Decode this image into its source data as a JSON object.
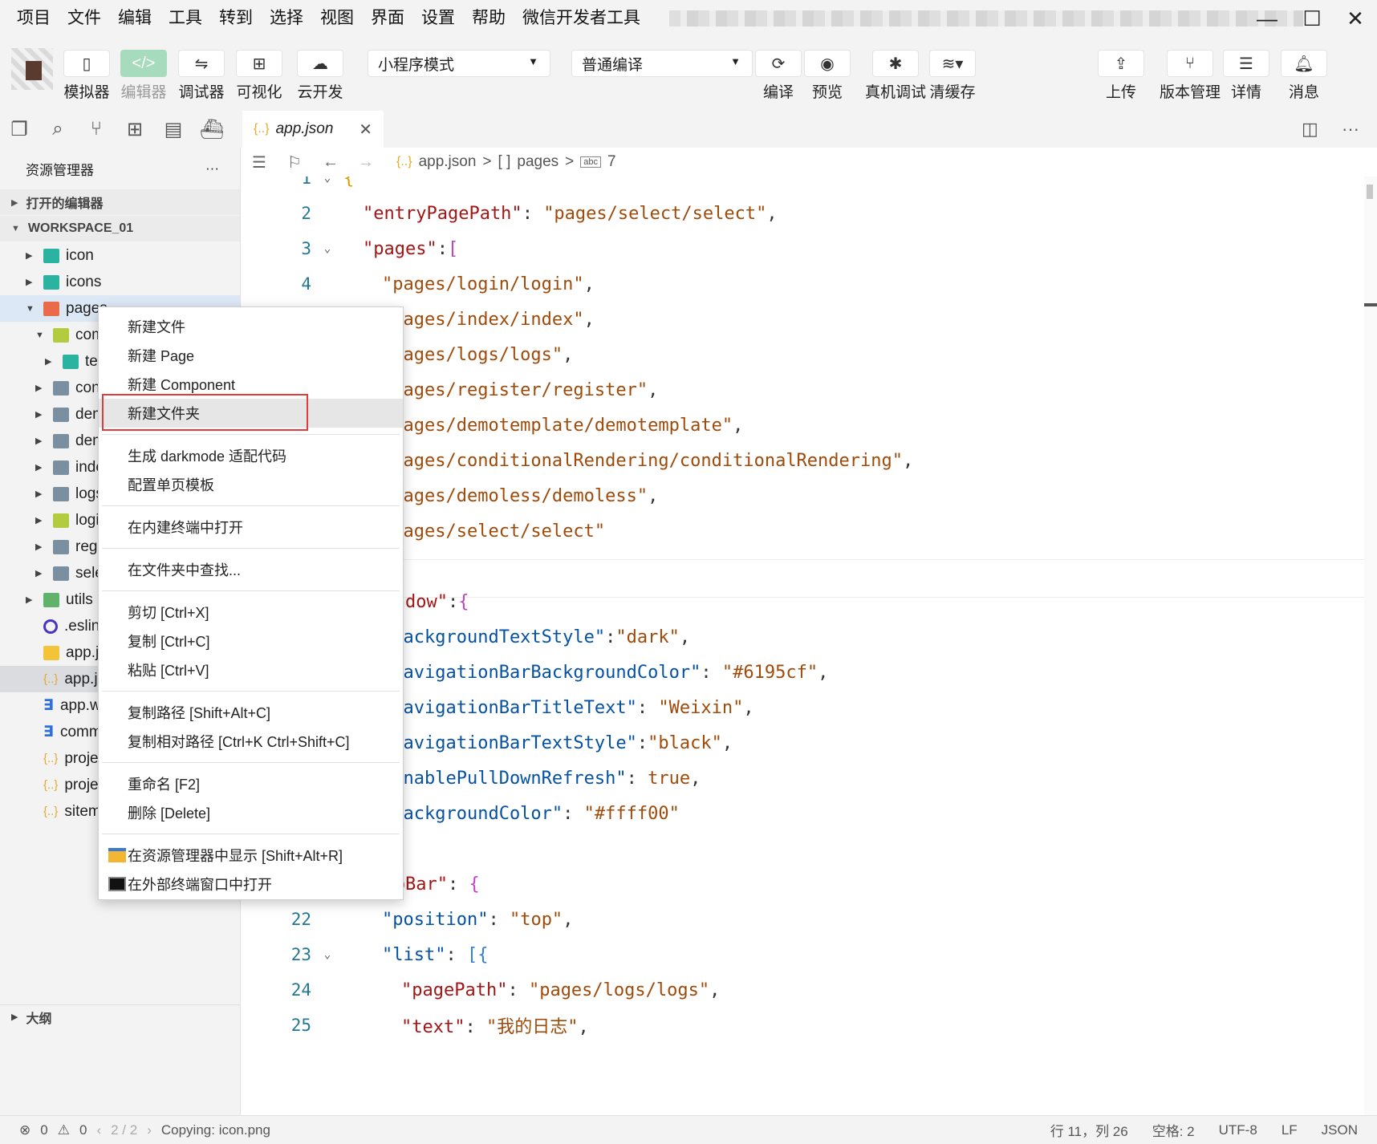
{
  "menubar": {
    "items": [
      "项目",
      "文件",
      "编辑",
      "工具",
      "转到",
      "选择",
      "视图",
      "界面",
      "设置",
      "帮助",
      "微信开发者工具"
    ],
    "window_controls": [
      "—",
      "☐",
      "✕"
    ]
  },
  "toolbar": {
    "simulator": "模拟器",
    "editor": "编辑器",
    "debugger": "调试器",
    "visual": "可视化",
    "cloud": "云开发",
    "mode_select": "小程序模式",
    "compile_select": "普通编译",
    "compile": "编译",
    "preview": "预览",
    "remote_debug": "真机调试",
    "clear_cache": "清缓存",
    "upload": "上传",
    "version": "版本管理",
    "details": "详情",
    "messages": "消息"
  },
  "sidebar": {
    "title": "资源管理器",
    "more": "···",
    "open_editors": "打开的编辑器",
    "workspace": "WORKSPACE_01",
    "outline": "大纲",
    "tree": [
      {
        "label": "icon",
        "icon": "folder-teal",
        "indent": 0,
        "arrow": "▶",
        "state": ""
      },
      {
        "label": "icons",
        "icon": "folder-teal",
        "indent": 0,
        "arrow": "▶",
        "state": ""
      },
      {
        "label": "pages",
        "icon": "folder-orange",
        "indent": 0,
        "arrow": "▼",
        "state": "active"
      },
      {
        "label": "components",
        "icon": "folder-lime",
        "indent": 1,
        "arrow": "▼",
        "state": ""
      },
      {
        "label": "te",
        "icon": "folder-teal",
        "indent": 2,
        "arrow": "▶",
        "state": ""
      },
      {
        "label": "conditionalRendering",
        "icon": "folder-gray",
        "indent": 1,
        "arrow": "▶",
        "state": ""
      },
      {
        "label": "demoless",
        "icon": "folder-gray",
        "indent": 1,
        "arrow": "▶",
        "state": ""
      },
      {
        "label": "demotemplate",
        "icon": "folder-gray",
        "indent": 1,
        "arrow": "▶",
        "state": ""
      },
      {
        "label": "index",
        "icon": "folder-gray",
        "indent": 1,
        "arrow": "▶",
        "state": ""
      },
      {
        "label": "logs",
        "icon": "folder-gray",
        "indent": 1,
        "arrow": "▶",
        "state": ""
      },
      {
        "label": "login",
        "icon": "folder-lime",
        "indent": 1,
        "arrow": "▶",
        "state": ""
      },
      {
        "label": "register",
        "icon": "folder-gray",
        "indent": 1,
        "arrow": "▶",
        "state": ""
      },
      {
        "label": "select",
        "icon": "folder-gray",
        "indent": 1,
        "arrow": "▶",
        "state": ""
      },
      {
        "label": "utils",
        "icon": "folder-green",
        "indent": 0,
        "arrow": "▶",
        "state": ""
      },
      {
        "label": ".eslintrc.js",
        "icon": "eslint",
        "indent": 0,
        "arrow": "",
        "state": ""
      },
      {
        "label": "app.js",
        "icon": "js",
        "indent": 0,
        "arrow": "",
        "state": ""
      },
      {
        "label": "app.json",
        "icon": "json",
        "indent": 0,
        "arrow": "",
        "state": "selected"
      },
      {
        "label": "app.wxss",
        "icon": "css",
        "indent": 0,
        "arrow": "",
        "state": ""
      },
      {
        "label": "common.wxss",
        "icon": "css",
        "indent": 0,
        "arrow": "",
        "state": ""
      },
      {
        "label": "project.config.json",
        "icon": "json",
        "indent": 0,
        "arrow": "",
        "state": ""
      },
      {
        "label": "project.private.config.json",
        "icon": "json",
        "indent": 0,
        "arrow": "",
        "state": ""
      },
      {
        "label": "sitemap.json",
        "icon": "json",
        "indent": 0,
        "arrow": "",
        "state": ""
      }
    ]
  },
  "tab": {
    "label": "app.json",
    "icon": "{..}",
    "close": "✕"
  },
  "breadcrumb": {
    "file": "app.json",
    "sep": ">",
    "array_icon": "[ ]",
    "pages": "pages",
    "item_index": "7"
  },
  "editor": {
    "lines": [
      {
        "n": "1",
        "fold": "⌄",
        "indent": 0,
        "parts": [
          [
            "b1",
            "{"
          ]
        ]
      },
      {
        "n": "2",
        "fold": "",
        "indent": 1,
        "parts": [
          [
            "k",
            "\"entryPagePath\""
          ],
          [
            "p",
            ": "
          ],
          [
            "s",
            "\"pages/select/select\""
          ],
          [
            "p",
            ","
          ]
        ]
      },
      {
        "n": "3",
        "fold": "⌄",
        "indent": 1,
        "parts": [
          [
            "k",
            "\"pages\""
          ],
          [
            "p",
            ":"
          ],
          [
            "b2",
            "["
          ]
        ]
      },
      {
        "n": "4",
        "fold": "",
        "indent": 2,
        "parts": [
          [
            "s",
            "\"pages/login/login\""
          ],
          [
            "p",
            ","
          ]
        ]
      },
      {
        "n": "5",
        "fold": "",
        "indent": 2,
        "parts": [
          [
            "s",
            "\"pages/index/index\""
          ],
          [
            "p",
            ","
          ]
        ]
      },
      {
        "n": "6",
        "fold": "",
        "indent": 2,
        "parts": [
          [
            "s",
            "\"pages/logs/logs\""
          ],
          [
            "p",
            ","
          ]
        ]
      },
      {
        "n": "7",
        "fold": "",
        "indent": 2,
        "parts": [
          [
            "s",
            "\"pages/register/register\""
          ],
          [
            "p",
            ","
          ]
        ]
      },
      {
        "n": "8",
        "fold": "",
        "indent": 2,
        "parts": [
          [
            "s",
            "\"pages/demotemplate/demotemplate\""
          ],
          [
            "p",
            ","
          ]
        ]
      },
      {
        "n": "9",
        "fold": "",
        "indent": 2,
        "parts": [
          [
            "s",
            "\"pages/conditionalRendering/conditionalRendering\""
          ],
          [
            "p",
            ","
          ]
        ]
      },
      {
        "n": "10",
        "fold": "",
        "indent": 2,
        "parts": [
          [
            "s",
            "\"pages/demoless/demoless\""
          ],
          [
            "p",
            ","
          ]
        ]
      },
      {
        "n": "11",
        "fold": "",
        "indent": 2,
        "parts": [
          [
            "s",
            "\"pages/select/select\""
          ]
        ]
      },
      {
        "n": "12",
        "fold": "",
        "indent": 1,
        "parts": [
          [
            "b2",
            "]"
          ],
          [
            "p",
            ","
          ]
        ]
      },
      {
        "n": "13",
        "fold": "⌄",
        "indent": 1,
        "parts": [
          [
            "k",
            "\"window\""
          ],
          [
            "p",
            ":"
          ],
          [
            "b2",
            "{"
          ]
        ]
      },
      {
        "n": "14",
        "fold": "",
        "indent": 2,
        "parts": [
          [
            "k2",
            "\"backgroundTextStyle\""
          ],
          [
            "p",
            ":"
          ],
          [
            "s",
            "\"dark\""
          ],
          [
            "p",
            ","
          ]
        ]
      },
      {
        "n": "15",
        "fold": "",
        "indent": 2,
        "parts": [
          [
            "k2",
            "\"navigationBarBackgroundColor\""
          ],
          [
            "p",
            ": "
          ],
          [
            "s",
            "\"#6195cf\""
          ],
          [
            "p",
            ","
          ]
        ]
      },
      {
        "n": "16",
        "fold": "",
        "indent": 2,
        "parts": [
          [
            "k2",
            "\"navigationBarTitleText\""
          ],
          [
            "p",
            ": "
          ],
          [
            "s",
            "\"Weixin\""
          ],
          [
            "p",
            ","
          ]
        ]
      },
      {
        "n": "17",
        "fold": "",
        "indent": 2,
        "parts": [
          [
            "k2",
            "\"navigationBarTextStyle\""
          ],
          [
            "p",
            ":"
          ],
          [
            "s",
            "\"black\""
          ],
          [
            "p",
            ","
          ]
        ]
      },
      {
        "n": "18",
        "fold": "",
        "indent": 2,
        "parts": [
          [
            "k2",
            "\"enablePullDownRefresh\""
          ],
          [
            "p",
            ": "
          ],
          [
            "kw",
            "true"
          ],
          [
            "p",
            ","
          ]
        ]
      },
      {
        "n": "19",
        "fold": "",
        "indent": 2,
        "parts": [
          [
            "k2",
            "\"backgroundColor\""
          ],
          [
            "p",
            ": "
          ],
          [
            "s",
            "\"#ffff00\""
          ]
        ]
      },
      {
        "n": "20",
        "fold": "",
        "indent": 1,
        "parts": [
          [
            "b2",
            "}"
          ],
          [
            "p",
            ","
          ]
        ]
      },
      {
        "n": "21",
        "fold": "⌄",
        "indent": 1,
        "parts": [
          [
            "k",
            "\"tabBar\""
          ],
          [
            "p",
            ": "
          ],
          [
            "b2",
            "{"
          ]
        ]
      },
      {
        "n": "22",
        "fold": "",
        "indent": 2,
        "parts": [
          [
            "k2",
            "\"position\""
          ],
          [
            "p",
            ": "
          ],
          [
            "s",
            "\"top\""
          ],
          [
            "p",
            ","
          ]
        ]
      },
      {
        "n": "23",
        "fold": "⌄",
        "indent": 2,
        "parts": [
          [
            "k2",
            "\"list\""
          ],
          [
            "p",
            ": "
          ],
          [
            "b3",
            "[{"
          ]
        ]
      },
      {
        "n": "24",
        "fold": "",
        "indent": 3,
        "parts": [
          [
            "k",
            "\"pagePath\""
          ],
          [
            "p",
            ": "
          ],
          [
            "s",
            "\"pages/logs/logs\""
          ],
          [
            "p",
            ","
          ]
        ]
      },
      {
        "n": "25",
        "fold": "",
        "indent": 3,
        "parts": [
          [
            "k",
            "\"text\""
          ],
          [
            "p",
            ": "
          ],
          [
            "s",
            "\"我的日志\""
          ],
          [
            "p",
            ","
          ]
        ]
      }
    ]
  },
  "context_menu": {
    "groups": [
      [
        {
          "label": "新建文件"
        },
        {
          "label": "新建 Page"
        },
        {
          "label": "新建 Component"
        },
        {
          "label": "新建文件夹",
          "hover": true
        }
      ],
      [
        {
          "label": "生成 darkmode 适配代码"
        },
        {
          "label": "配置单页模板"
        }
      ],
      [
        {
          "label": "在内建终端中打开"
        }
      ],
      [
        {
          "label": "在文件夹中查找..."
        }
      ],
      [
        {
          "label": "剪切  [Ctrl+X]"
        },
        {
          "label": "复制  [Ctrl+C]"
        },
        {
          "label": "粘贴  [Ctrl+V]"
        }
      ],
      [
        {
          "label": "复制路径  [Shift+Alt+C]"
        },
        {
          "label": "复制相对路径  [Ctrl+K Ctrl+Shift+C]"
        }
      ],
      [
        {
          "label": "重命名  [F2]"
        },
        {
          "label": "删除  [Delete]"
        }
      ],
      [
        {
          "label": "在资源管理器中显示  [Shift+Alt+R]",
          "icon": "explorer-folder-icon"
        },
        {
          "label": "在外部终端窗口中打开",
          "icon": "terminal-icon"
        }
      ]
    ]
  },
  "statusbar": {
    "errors": "0",
    "warnings": "0",
    "pager": "2 / 2",
    "message": "Copying: icon.png",
    "position": "行 11，列 26",
    "spaces": "空格: 2",
    "encoding": "UTF-8",
    "eol": "LF",
    "language": "JSON"
  },
  "colors": {
    "accent_green": "#a7dbbd",
    "highlight_red": "#e23b3b",
    "string_color": "#a04a0a",
    "key_color": "#a31515"
  }
}
